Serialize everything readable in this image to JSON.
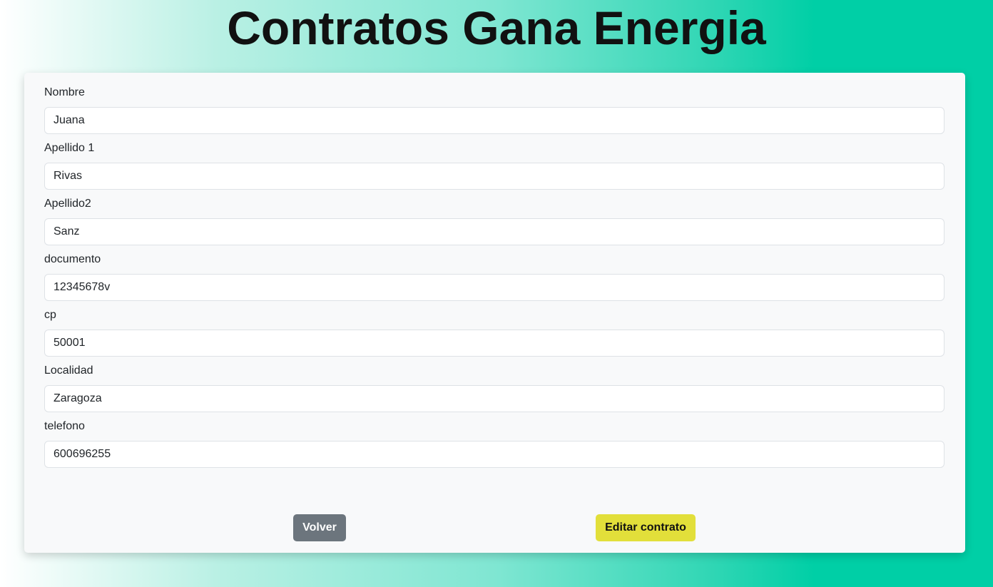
{
  "header": {
    "title": "Contratos Gana Energia"
  },
  "form": {
    "fields": [
      {
        "label": "Nombre",
        "value": "Juana"
      },
      {
        "label": "Apellido 1",
        "value": "Rivas"
      },
      {
        "label": "Apellido2",
        "value": "Sanz"
      },
      {
        "label": "documento",
        "value": "12345678v"
      },
      {
        "label": "cp",
        "value": "50001"
      },
      {
        "label": "Localidad",
        "value": "Zaragoza"
      },
      {
        "label": "telefono",
        "value": "600696255"
      }
    ]
  },
  "actions": {
    "back_label": "Volver",
    "edit_label": "Editar contrato"
  },
  "colors": {
    "gradient_start": "#ffffff",
    "gradient_end": "#00cfa6",
    "back_button": "#6c757d",
    "edit_button": "#e2df3a"
  }
}
